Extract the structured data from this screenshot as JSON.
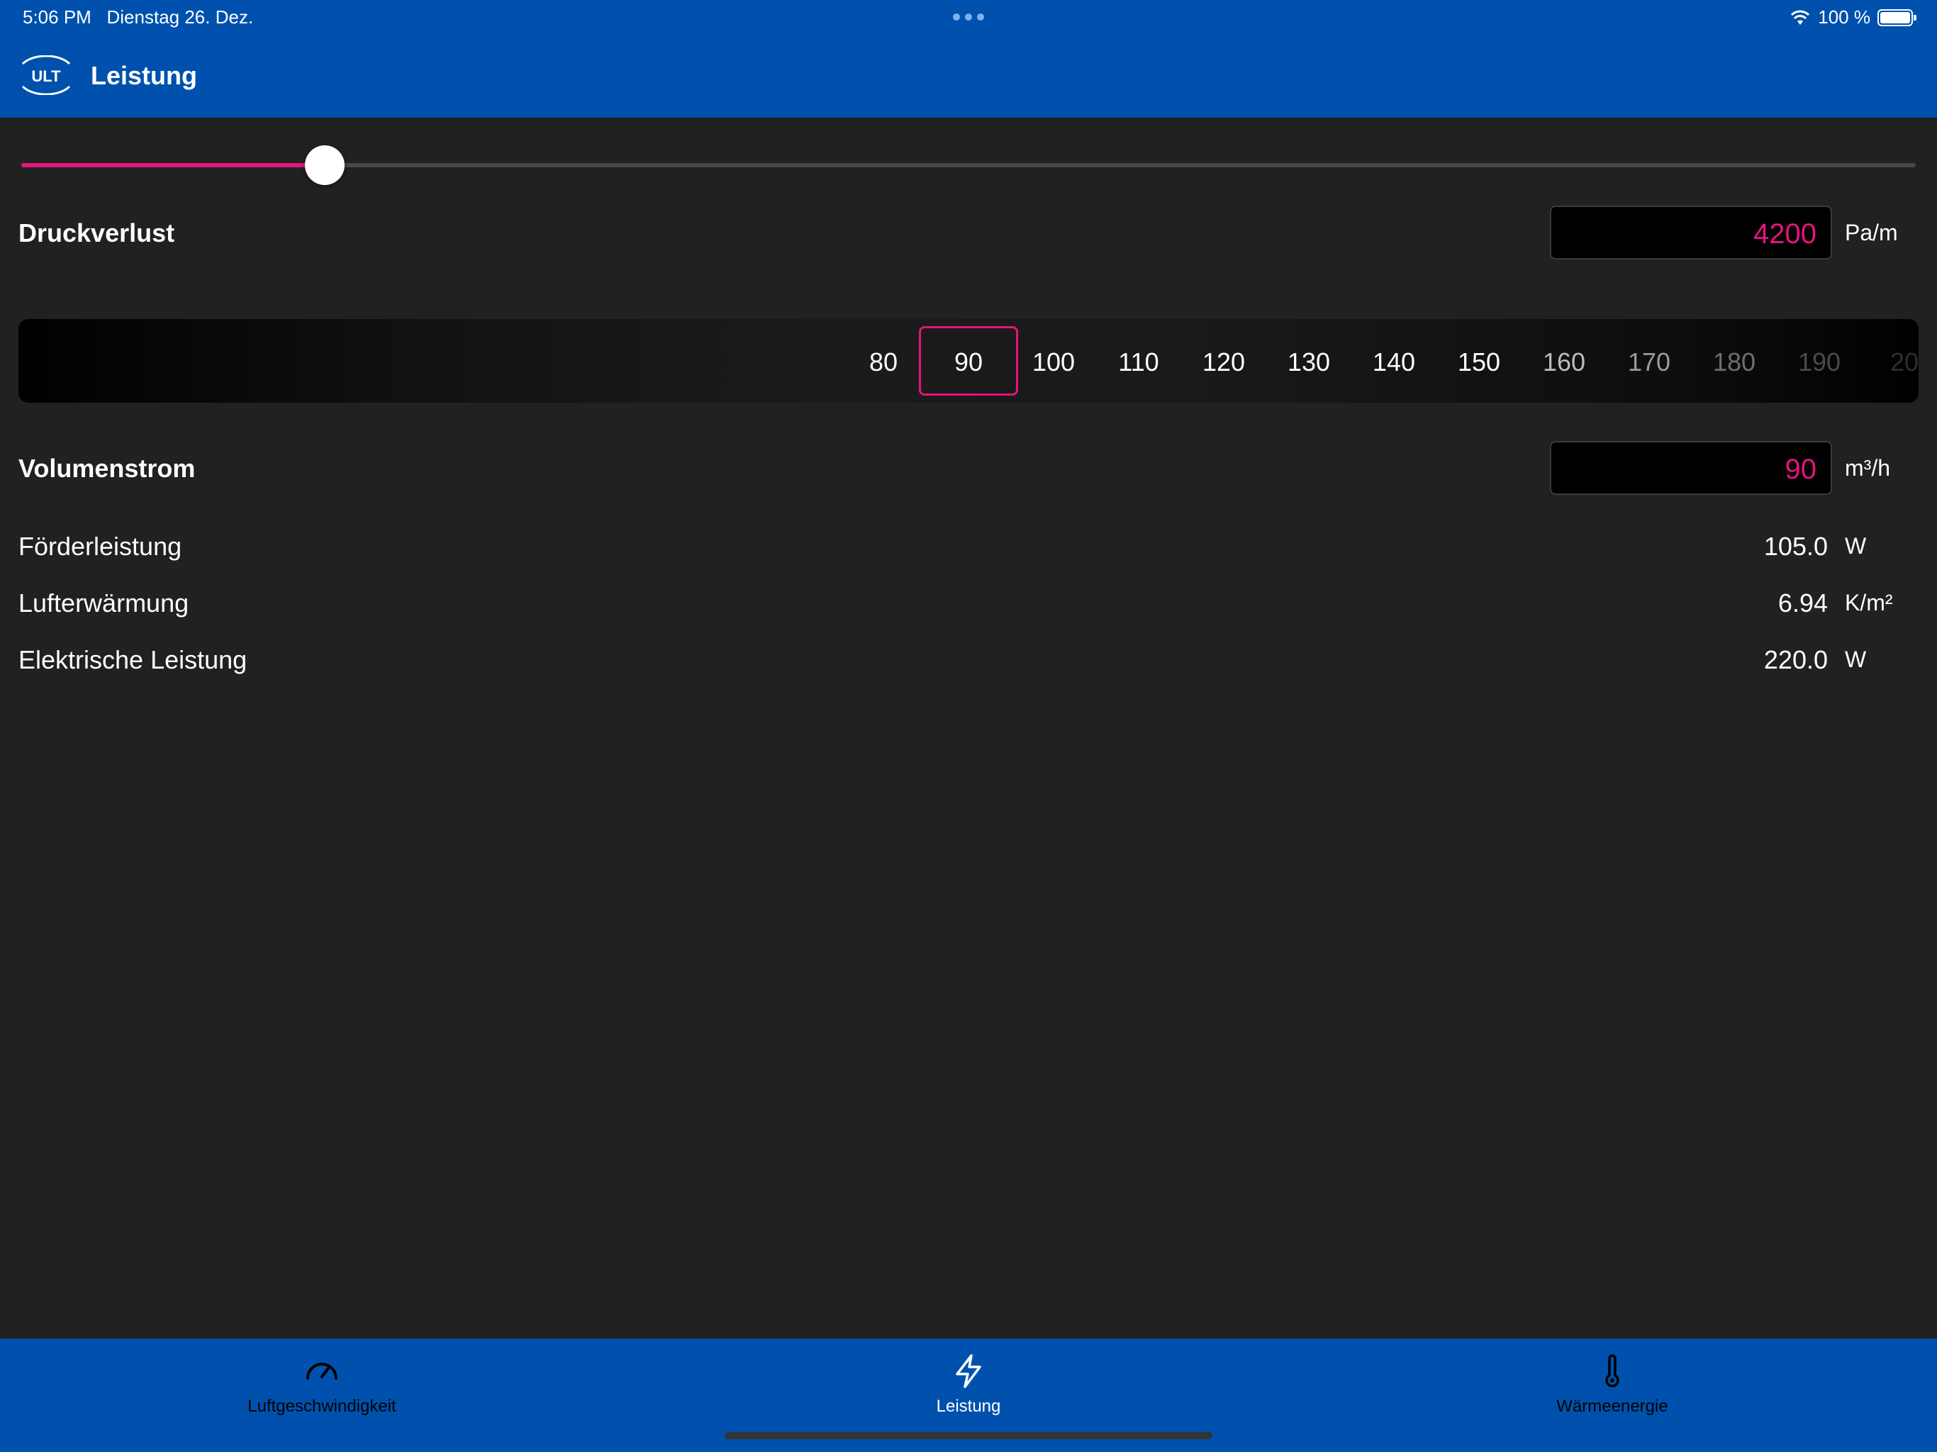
{
  "status": {
    "time": "5:06 PM",
    "date": "Dienstag 26. Dez.",
    "battery": "100 %"
  },
  "header": {
    "logo_text": "ULT",
    "title": "Leistung"
  },
  "slider": {
    "value_fraction": 0.16
  },
  "druckverlust": {
    "label": "Druckverlust",
    "value": "4200",
    "unit": "Pa/m"
  },
  "picker": {
    "values": [
      "80",
      "90",
      "100",
      "110",
      "120",
      "130",
      "140",
      "150",
      "160",
      "170",
      "180",
      "190",
      "20"
    ],
    "selected": "90"
  },
  "volumenstrom": {
    "label": "Volumenstrom",
    "value": "90",
    "unit": "m³/h"
  },
  "results": [
    {
      "label": "Förderleistung",
      "value": "105.0",
      "unit": "W"
    },
    {
      "label": "Lufterwärmung",
      "value": "6.94",
      "unit": "K/m²"
    },
    {
      "label": "Elektrische Leistung",
      "value": "220.0",
      "unit": "W"
    }
  ],
  "tabs": [
    {
      "label": "Luftgeschwindigkeit",
      "icon": "speedometer-icon"
    },
    {
      "label": "Leistung",
      "icon": "bolt-icon"
    },
    {
      "label": "Wärmeenergie",
      "icon": "thermometer-icon"
    }
  ],
  "colors": {
    "brand_blue": "#0051ad",
    "accent_pink": "#e6137d",
    "background": "#212121"
  }
}
